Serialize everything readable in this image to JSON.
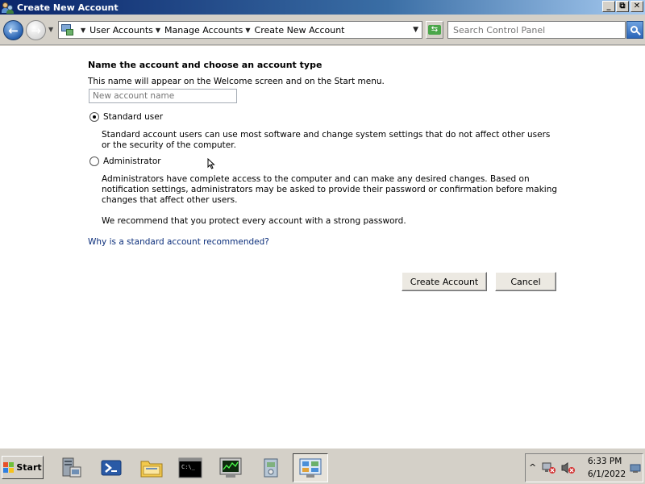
{
  "window": {
    "title": "Create New Account",
    "controls": {
      "minimize": "_",
      "restore": "⧉",
      "close": "✕"
    }
  },
  "navigation": {
    "breadcrumbs": [
      "User Accounts",
      "Manage Accounts",
      "Create New Account"
    ],
    "search_placeholder": "Search Control Panel"
  },
  "form": {
    "heading": "Name the account and choose an account type",
    "subtitle": "This name will appear on the Welcome screen and on the Start menu.",
    "name_placeholder": "New account name",
    "name_value": "",
    "options": [
      {
        "label": "Standard user",
        "selected": true,
        "description": "Standard account users can use most software and change system settings that do not affect other users or the security of the computer."
      },
      {
        "label": "Administrator",
        "selected": false,
        "description": "Administrators have complete access to the computer and can make any desired changes. Based on notification settings, administrators may be asked to provide their password or confirmation before making changes that affect other users."
      }
    ],
    "recommendation": "We recommend that you protect every account with a strong password.",
    "help_link": "Why is a standard account recommended?",
    "buttons": {
      "create": "Create Account",
      "cancel": "Cancel"
    }
  },
  "taskbar": {
    "start_label": "Start",
    "pinned": [
      "server-manager",
      "powershell",
      "explorer",
      "command-prompt",
      "task-manager",
      "install-tool",
      "control-panel"
    ],
    "active": "control-panel",
    "clock": {
      "time": "6:33 PM",
      "date": "6/1/2022"
    },
    "tray_chevron": "^"
  },
  "colors": {
    "title_bar": "#0a246a",
    "link": "#0a2d7a",
    "chrome": "#d4d0c8"
  }
}
